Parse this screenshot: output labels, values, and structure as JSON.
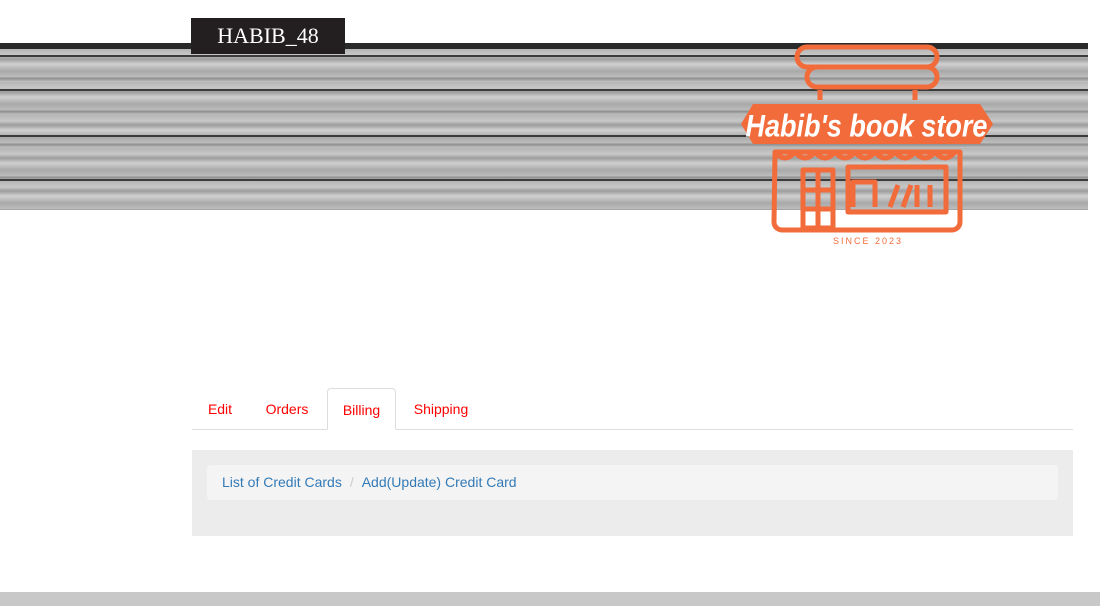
{
  "header": {
    "username": "HABIB_48",
    "logo": {
      "name": "Habib's book store",
      "since": "SINCE 2023",
      "color": "#f26b3a"
    }
  },
  "tabs": [
    {
      "label": "Edit"
    },
    {
      "label": "Orders"
    },
    {
      "label": "Billing",
      "active": true
    },
    {
      "label": "Shipping"
    }
  ],
  "breadcrumb": {
    "items": [
      {
        "label": "List of Credit Cards"
      },
      {
        "label": "Add(Update) Credit Card"
      }
    ],
    "separator": "/"
  },
  "colors": {
    "tab_text": "#ff0000",
    "link": "#337ab7"
  }
}
